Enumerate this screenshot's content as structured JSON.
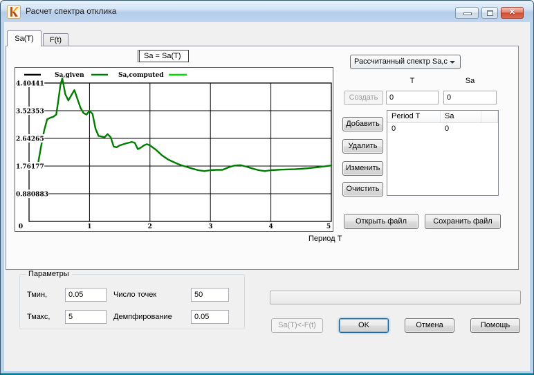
{
  "window": {
    "title": "Расчет спектра отклика"
  },
  "titlebar_buttons": {
    "minimize": "minimize",
    "maximize": "maximize",
    "close_glyph": "x"
  },
  "tabs": [
    {
      "label": "Sa(T)",
      "active": true
    },
    {
      "label": "F(t)",
      "active": false
    }
  ],
  "chart_data": {
    "type": "line",
    "title": "Sa = Sa(T)",
    "xlabel": "Период T",
    "ylabel": "",
    "xlim": [
      0,
      5
    ],
    "ylim": [
      0,
      4.8448
    ],
    "xticks": [
      0,
      1,
      2,
      3,
      4,
      5
    ],
    "yticks": [
      0.880883,
      1.76177,
      2.64265,
      3.52353,
      4.40441
    ],
    "ytick_labels": [
      "0.880883",
      "1.76177",
      "2.64265",
      "3.52353",
      "4.40441"
    ],
    "grid": true,
    "legend_position": "top",
    "legend": [
      {
        "label": "Sa,given",
        "color": "#000000"
      },
      {
        "label": "Sa,computed",
        "color": "#007d00"
      },
      {
        "label": "",
        "color": "#00dc00"
      }
    ],
    "series": [
      {
        "name": "Sa,computed",
        "color": "#007d00",
        "x": [
          0.15,
          0.2,
          0.25,
          0.3,
          0.35,
          0.4,
          0.45,
          0.48,
          0.52,
          0.55,
          0.6,
          0.65,
          0.7,
          0.75,
          0.8,
          0.85,
          0.9,
          0.95,
          1.0,
          1.05,
          1.1,
          1.15,
          1.2,
          1.25,
          1.3,
          1.35,
          1.4,
          1.45,
          1.5,
          1.6,
          1.7,
          1.75,
          1.8,
          1.85,
          1.9,
          1.95,
          2.0,
          2.1,
          2.2,
          2.3,
          2.4,
          2.5,
          2.6,
          2.7,
          2.8,
          2.9,
          3.0,
          3.1,
          3.2,
          3.3,
          3.4,
          3.5,
          3.6,
          3.7,
          3.8,
          3.9,
          4.0,
          4.2,
          4.4,
          4.6,
          4.8,
          5.0
        ],
        "y": [
          1.85,
          2.4,
          2.9,
          3.25,
          3.3,
          3.33,
          3.4,
          3.8,
          4.35,
          4.55,
          4.05,
          3.85,
          4.02,
          4.18,
          3.9,
          3.62,
          3.45,
          3.4,
          3.52,
          3.42,
          2.95,
          2.72,
          2.7,
          2.68,
          2.78,
          2.68,
          2.38,
          2.36,
          2.42,
          2.48,
          2.53,
          2.5,
          2.3,
          2.35,
          2.42,
          2.46,
          2.42,
          2.28,
          2.1,
          1.97,
          1.88,
          1.8,
          1.74,
          1.68,
          1.63,
          1.6,
          1.63,
          1.64,
          1.64,
          1.72,
          1.78,
          1.79,
          1.74,
          1.68,
          1.63,
          1.6,
          1.63,
          1.65,
          1.66,
          1.69,
          1.73,
          1.78
        ]
      }
    ]
  },
  "right_panel": {
    "combo": {
      "value": "Рассчитанный спектр Sa,c"
    },
    "t_label": "T",
    "sa_label": "Sa",
    "t_value": "0",
    "sa_value": "0",
    "buttons": {
      "create": "Создать",
      "add": "Добавить",
      "delete": "Удалить",
      "edit": "Изменить",
      "clear": "Очистить",
      "open_file": "Открыть файл",
      "save_file": "Сохранить файл"
    },
    "table": {
      "headers": [
        "Period T",
        "Sa"
      ],
      "rows": [
        [
          "0",
          "0"
        ]
      ]
    }
  },
  "params": {
    "legend": "Параметры",
    "tmin_label": "Тмин,",
    "tmin_value": "0.05",
    "npoints_label": "Число точек",
    "npoints_value": "50",
    "tmax_label": "Тмакс,",
    "tmax_value": "5",
    "damping_label": "Демпфирование",
    "damping_value": "0.05"
  },
  "footer": {
    "convert": "Sa(T)<-F(t)",
    "ok": "OK",
    "cancel": "Отмена",
    "help": "Помощь"
  },
  "colors": {
    "close_button": "#cf5036",
    "curve": "#007d00",
    "bright_green": "#00dc00",
    "frame": "#b8d2ec"
  }
}
